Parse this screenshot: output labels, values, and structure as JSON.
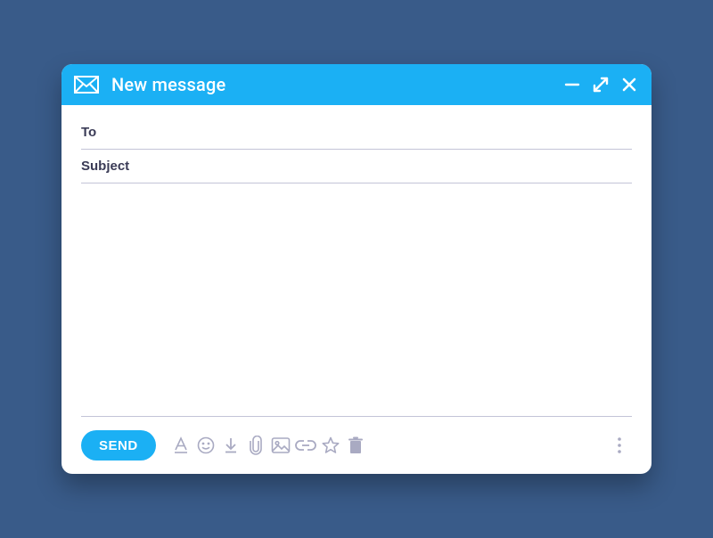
{
  "titlebar": {
    "title": "New message"
  },
  "fields": {
    "to_placeholder": "To",
    "to_value": "",
    "subject_placeholder": "Subject",
    "subject_value": "",
    "message_value": ""
  },
  "toolbar": {
    "send_label": "SEND"
  }
}
